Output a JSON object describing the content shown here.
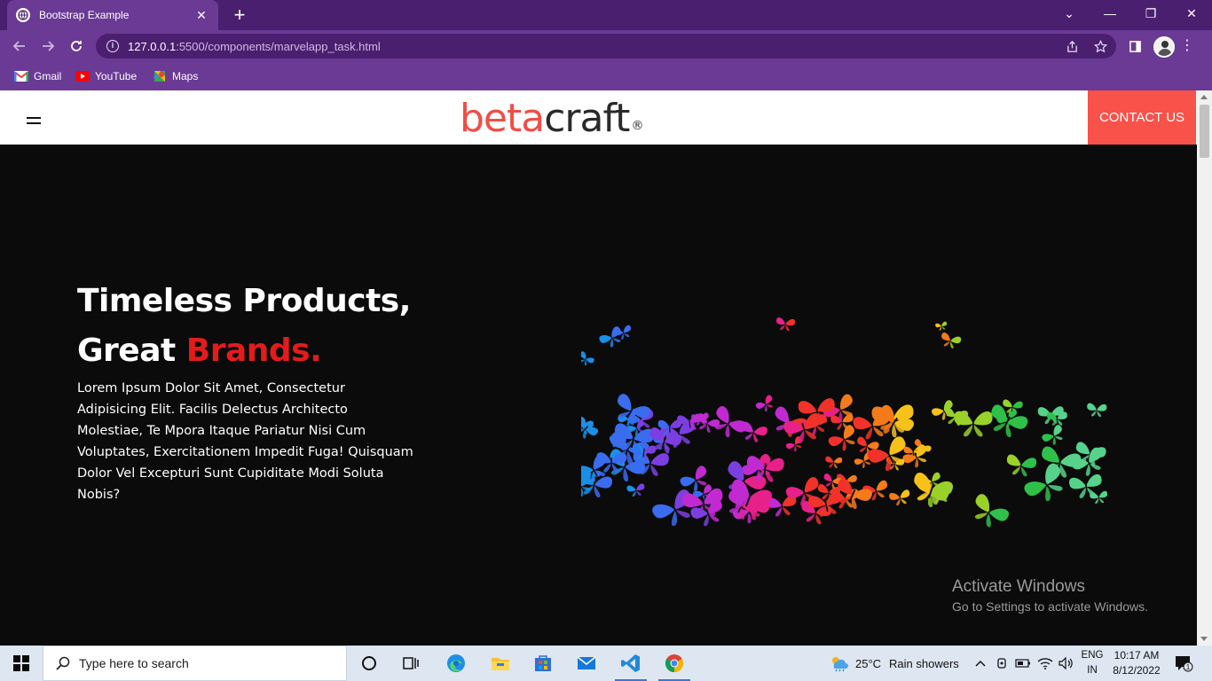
{
  "browser": {
    "tab_title": "Bootstrap Example",
    "url_host": "127.0.0.1",
    "url_rest": ":5500/components/marvelapp_task.html",
    "bookmarks": [
      {
        "label": "Gmail",
        "icon": "gmail-icon"
      },
      {
        "label": "YouTube",
        "icon": "youtube-icon"
      },
      {
        "label": "Maps",
        "icon": "maps-icon"
      }
    ]
  },
  "site": {
    "logo_part1": "beta",
    "logo_part2": "craft",
    "logo_reg": "®",
    "contact_label": "CONTACT US",
    "hero": {
      "line1": "Timeless Products,",
      "line2_plain": "Great ",
      "line2_accent": "Brands.",
      "body": "Lorem Ipsum Dolor Sit Amet, Consectetur Adipisicing Elit. Facilis Delectus Architecto Molestiae, Te Mpora Itaque Pariatur Nisi Cum Voluptates, Exercitationem Impedit Fuga! Quisquam Dolor Vel Excepturi Sunt Cupiditate Modi Soluta Nobis?"
    }
  },
  "watermark": {
    "title": "Activate Windows",
    "subtitle": "Go to Settings to activate Windows."
  },
  "taskbar": {
    "search_placeholder": "Type here to search",
    "weather_temp": "25°C",
    "weather_text": "Rain showers",
    "lang_top": "ENG",
    "lang_bottom": "IN",
    "time": "10:17 AM",
    "date": "8/12/2022",
    "notification_count": "1"
  },
  "colors": {
    "chrome_dark": "#4b1f6f",
    "chrome_light": "#6a3a95",
    "brand_red": "#f04e45",
    "accent_red": "#e41b1b",
    "contact_bg": "#f8524a"
  }
}
